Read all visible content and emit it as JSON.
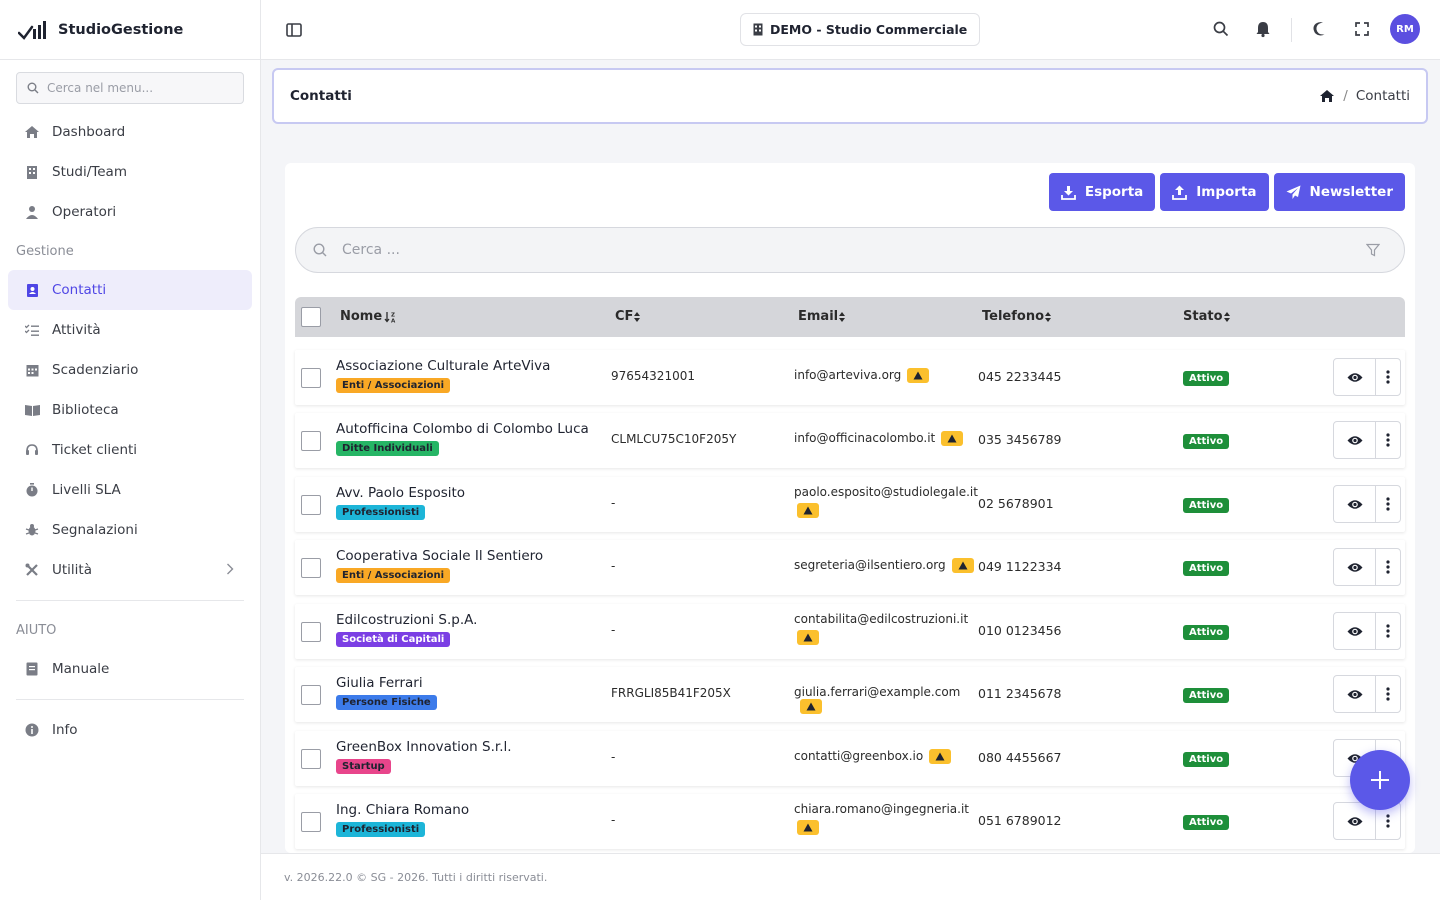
{
  "brand": {
    "name": "StudioGestione"
  },
  "sidebar": {
    "search_placeholder": "Cerca nel menu...",
    "items": [
      {
        "label": "Dashboard",
        "icon": "home-icon"
      },
      {
        "label": "Studi/Team",
        "icon": "building-icon"
      },
      {
        "label": "Operatori",
        "icon": "user-icon"
      }
    ],
    "section_gestione": "Gestione",
    "gestione_items": [
      {
        "label": "Contatti",
        "icon": "contact-card-icon",
        "active": true
      },
      {
        "label": "Attività",
        "icon": "list-check-icon"
      },
      {
        "label": "Scadenziario",
        "icon": "calendar-icon"
      },
      {
        "label": "Biblioteca",
        "icon": "book-icon"
      },
      {
        "label": "Ticket clienti",
        "icon": "headset-icon"
      },
      {
        "label": "Livelli SLA",
        "icon": "stopwatch-icon"
      },
      {
        "label": "Segnalazioni",
        "icon": "bug-icon"
      },
      {
        "label": "Utilità",
        "icon": "tools-icon"
      }
    ],
    "section_aiuto": "AIUTO",
    "aiuto_items": [
      {
        "label": "Manuale",
        "icon": "manual-icon"
      }
    ],
    "info_label": "Info"
  },
  "topbar": {
    "studio": "DEMO - Studio Commerciale",
    "avatar_initials": "RM"
  },
  "page": {
    "title": "Contatti",
    "breadcrumb_current": "Contatti"
  },
  "actions": {
    "export": "Esporta",
    "import": "Importa",
    "newsletter": "Newsletter"
  },
  "search": {
    "placeholder": "Cerca ..."
  },
  "table": {
    "headers": {
      "name": "Nome",
      "cf": "CF",
      "email": "Email",
      "phone": "Telefono",
      "status": "Stato"
    },
    "rows": [
      {
        "name": "Associazione Culturale ArteViva",
        "tag": "Enti / Associazioni",
        "cf": "97654321001",
        "email": "info@arteviva.org",
        "phone": "045 2233445",
        "status": "Attivo"
      },
      {
        "name": "Autofficina Colombo di Colombo Luca",
        "tag": "Ditte Individuali",
        "cf": "CLMLCU75C10F205Y",
        "email": "info@officinacolombo.it",
        "phone": "035 3456789",
        "status": "Attivo"
      },
      {
        "name": "Avv. Paolo Esposito",
        "tag": "Professionisti",
        "cf": "-",
        "email": "paolo.esposito@studiolegale.it",
        "phone": "02 5678901",
        "status": "Attivo"
      },
      {
        "name": "Cooperativa Sociale Il Sentiero",
        "tag": "Enti / Associazioni",
        "cf": "-",
        "email": "segreteria@ilsentiero.org",
        "phone": "049 1122334",
        "status": "Attivo"
      },
      {
        "name": "Edilcostruzioni S.p.A.",
        "tag": "Società di Capitali",
        "cf": "-",
        "email": "contabilita@edilcostruzioni.it",
        "phone": "010 0123456",
        "status": "Attivo"
      },
      {
        "name": "Giulia Ferrari",
        "tag": "Persone Fisiche",
        "cf": "FRRGLI85B41F205X",
        "email": "giulia.ferrari@example.com",
        "phone": "011 2345678",
        "status": "Attivo"
      },
      {
        "name": "GreenBox Innovation S.r.l.",
        "tag": "Startup",
        "cf": "-",
        "email": "contatti@greenbox.io",
        "phone": "080 4455667",
        "status": "Attivo"
      },
      {
        "name": "Ing. Chiara Romano",
        "tag": "Professionisti",
        "cf": "-",
        "email": "chiara.romano@ingegneria.it",
        "phone": "051 6789012",
        "status": "Attivo"
      }
    ]
  },
  "footer": {
    "text": "v. 2026.22.0 © SG - 2026. Tutti i diritti riservati."
  },
  "colors": {
    "accent": "#5b58e8",
    "active_bg": "#eeedfb",
    "status_ok": "#1e8f3a",
    "warning": "#fbc02d"
  }
}
